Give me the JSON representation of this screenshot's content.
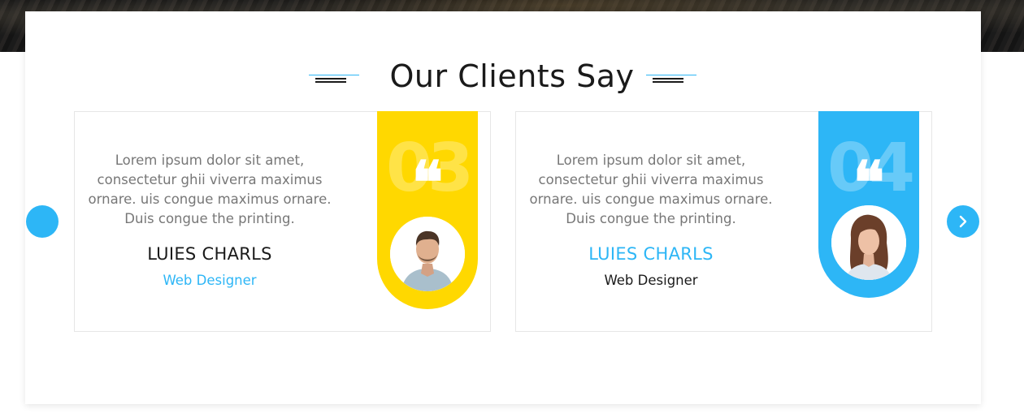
{
  "section": {
    "title": "Our Clients Say"
  },
  "colors": {
    "accent_blue": "#2db6f6",
    "accent_yellow": "#ffd800",
    "heading": "#1a1a1a",
    "body_text": "#777777"
  },
  "testimonials": [
    {
      "number": "03",
      "quote_icon": "quote-open-icon",
      "text": "Lorem ipsum dolor sit amet, consectetur ghii viverra maximus ornare. uis congue maximus ornare. Duis congue the printing.",
      "name": "LUIES CHARLS",
      "role": "Web Designer",
      "ribbon_color": "#ffd800",
      "name_color": "#1a1a1a",
      "role_color": "#2db6f6"
    },
    {
      "number": "04",
      "quote_icon": "quote-open-icon",
      "text": "Lorem ipsum dolor sit amet, consectetur ghii viverra maximus ornare. uis congue maximus ornare. Duis congue the printing.",
      "name": "LUIES CHARLS",
      "role": "Web Designer",
      "ribbon_color": "#2db6f6",
      "name_color": "#2db6f6",
      "role_color": "#1a1a1a"
    }
  ],
  "carousel": {
    "prev_icon": "arrow-left-icon",
    "next_icon": "chevron-right-icon"
  }
}
